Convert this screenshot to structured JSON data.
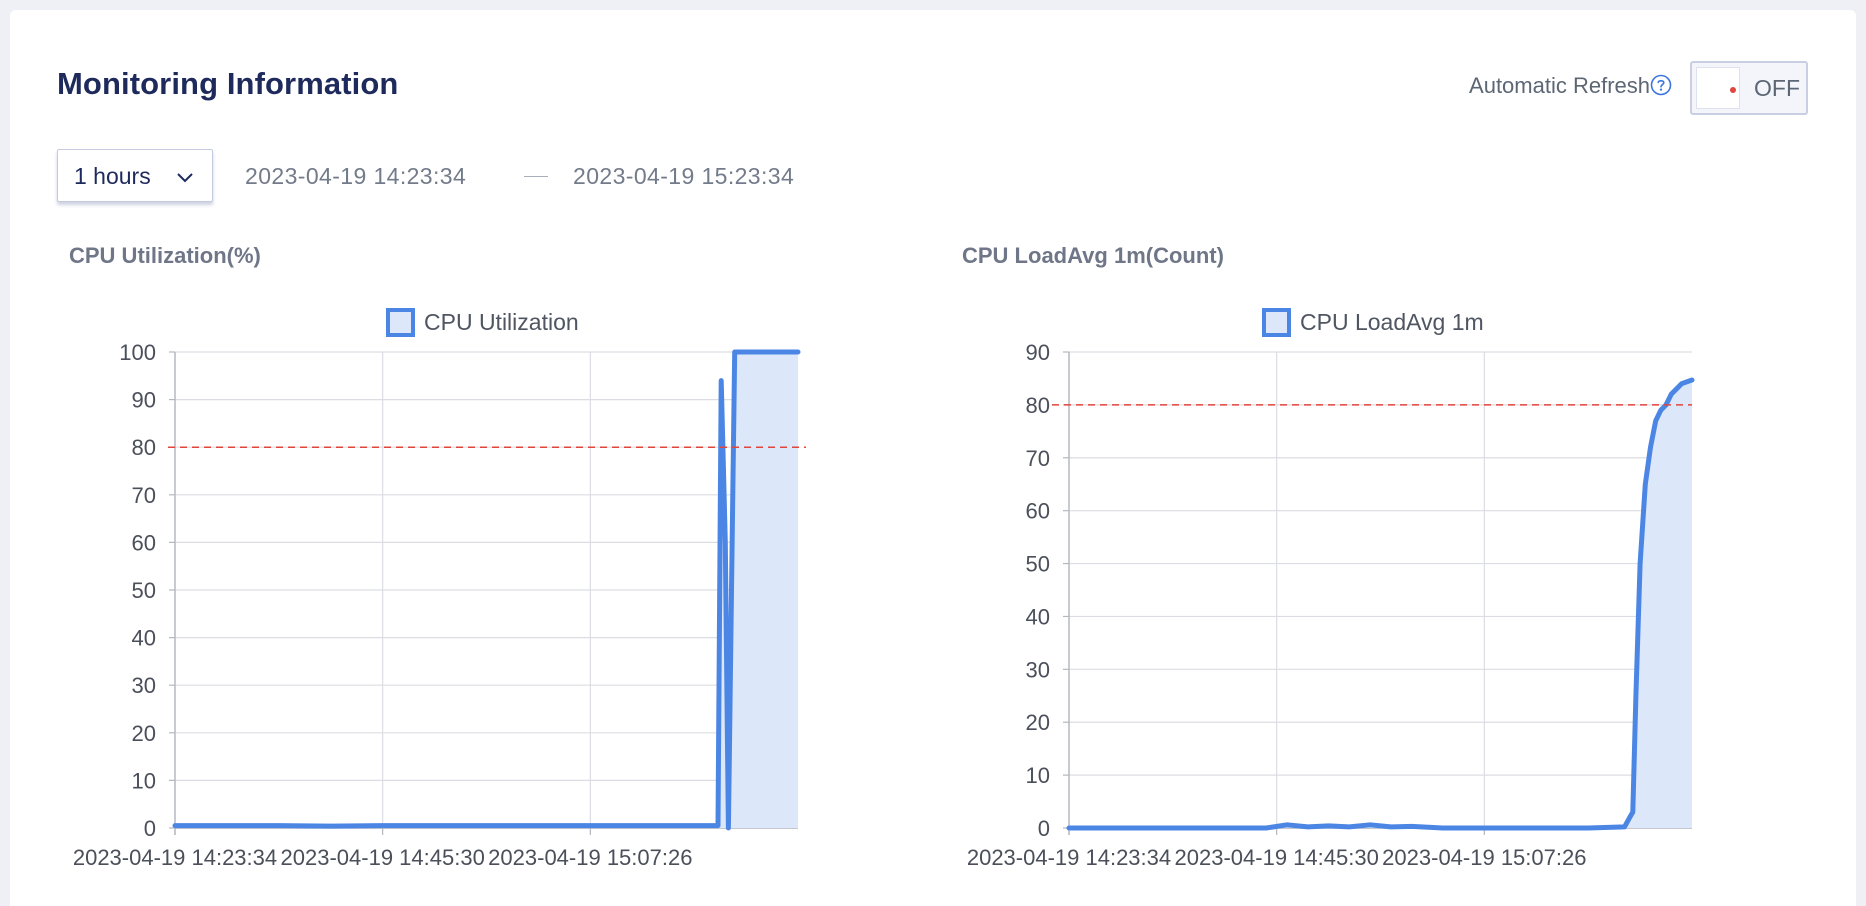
{
  "header": {
    "title": "Monitoring Information",
    "auto_refresh_label": "Automatic Refresh",
    "toggle_text": "OFF"
  },
  "range": {
    "selected": "1 hours",
    "start": "2023-04-19 14:23:34",
    "end": "2023-04-19 15:23:34"
  },
  "colors": {
    "line": "#4c86e4",
    "fill": "#dce7f9",
    "threshold": "#e2453c",
    "title": "#1d2a5b"
  },
  "chart_data": [
    {
      "type": "area",
      "title": "CPU Utilization(%)",
      "legend": "CPU Utilization",
      "ylim": [
        0,
        100
      ],
      "yticks": [
        0,
        10,
        20,
        30,
        40,
        50,
        60,
        70,
        80,
        90,
        100
      ],
      "xticks": [
        "2023-04-19 14:23:34",
        "2023-04-19 14:45:30",
        "2023-04-19 15:07:26"
      ],
      "x_range_minutes": [
        0,
        60
      ],
      "threshold": 80,
      "grid": true,
      "legend_position": "top-center",
      "x_minutes": [
        0,
        5,
        10,
        15,
        20,
        25,
        30,
        35,
        40,
        43,
        46,
        48,
        50,
        52.3,
        52.6,
        53.0,
        53.3,
        53.6,
        53.9,
        54.1,
        54.3,
        55,
        56,
        58,
        60
      ],
      "values": [
        0.5,
        0.5,
        0.5,
        0.4,
        0.5,
        0.5,
        0.5,
        0.5,
        0.5,
        0.5,
        0.5,
        0.5,
        0.5,
        0.5,
        94,
        60,
        0,
        50,
        100,
        100,
        100,
        100,
        100,
        100,
        100
      ]
    },
    {
      "type": "area",
      "title": "CPU LoadAvg 1m(Count)",
      "legend": "CPU LoadAvg 1m",
      "ylim": [
        0,
        90
      ],
      "yticks": [
        0,
        10,
        20,
        30,
        40,
        50,
        60,
        70,
        80,
        90
      ],
      "xticks": [
        "2023-04-19 14:23:34",
        "2023-04-19 14:45:30",
        "2023-04-19 15:07:26"
      ],
      "x_range_minutes": [
        0,
        60
      ],
      "threshold": 80,
      "grid": true,
      "legend_position": "top-center",
      "x_minutes": [
        0,
        10,
        19,
        21,
        23,
        25,
        27,
        29,
        31,
        33,
        36,
        40,
        45,
        50,
        53.5,
        54.0,
        54.3,
        54.6,
        55.0,
        55.5,
        56,
        56.5,
        57,
        57.5,
        58,
        59,
        60
      ],
      "values": [
        0,
        0,
        0,
        0.6,
        0.2,
        0.4,
        0.2,
        0.6,
        0.2,
        0.3,
        0,
        0,
        0,
        0,
        0.2,
        2,
        3,
        25,
        50,
        65,
        72,
        77,
        79,
        80,
        82,
        84,
        84.7
      ]
    }
  ]
}
